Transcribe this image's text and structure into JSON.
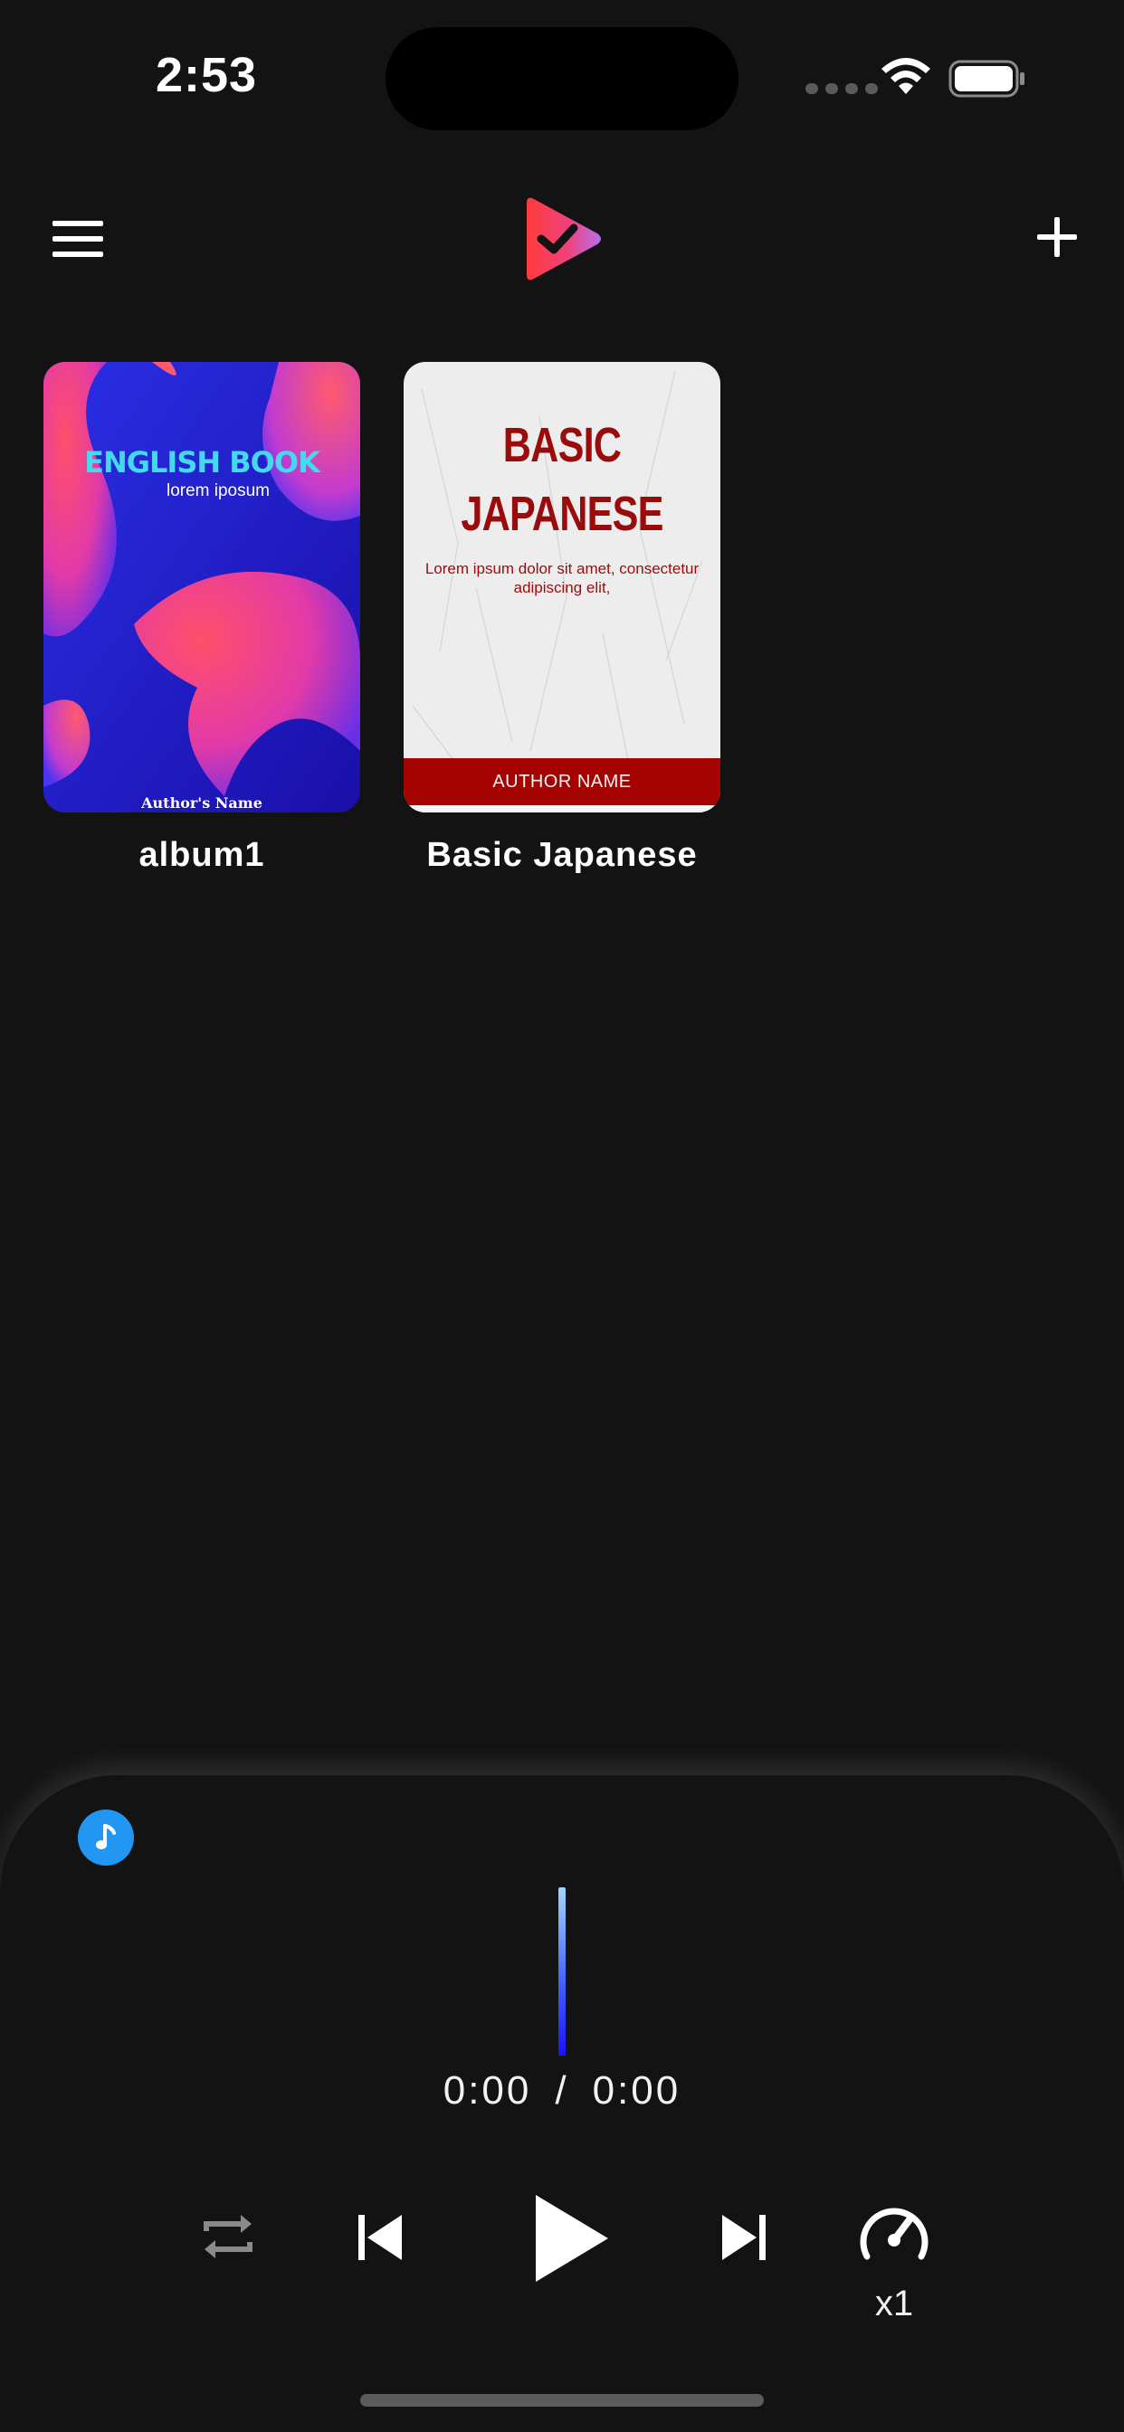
{
  "status_bar": {
    "time": "2:53",
    "icons": [
      "signal-dots-icon",
      "wifi-icon",
      "battery-icon"
    ]
  },
  "header": {
    "menu_icon": "hamburger-menu-icon",
    "logo_icon": "play-check-logo-icon",
    "add_icon": "plus-icon"
  },
  "albums": [
    {
      "title": "album1",
      "cover": {
        "headline": "ENGLISH BOOK",
        "subtitle": "lorem iposum",
        "author": "Author's Name"
      }
    },
    {
      "title": "Basic Japanese",
      "cover": {
        "headline_line1": "BASIC",
        "headline_line2": "JAPANESE",
        "description": "Lorem ipsum dolor sit amet, consectetur adipiscing elit,",
        "author": "AUTHOR NAME"
      }
    }
  ],
  "player": {
    "badge_icon": "music-note-icon",
    "current_time": "0:00",
    "separator": "/",
    "total_time": "0:00",
    "speed": "x1",
    "controls": [
      "repeat-icon",
      "skip-previous-icon",
      "play-icon",
      "skip-next-icon",
      "speedometer-icon"
    ]
  },
  "colors": {
    "background": "#131313",
    "accent_blue": "#2196f3",
    "japanese_red": "#a50202"
  }
}
